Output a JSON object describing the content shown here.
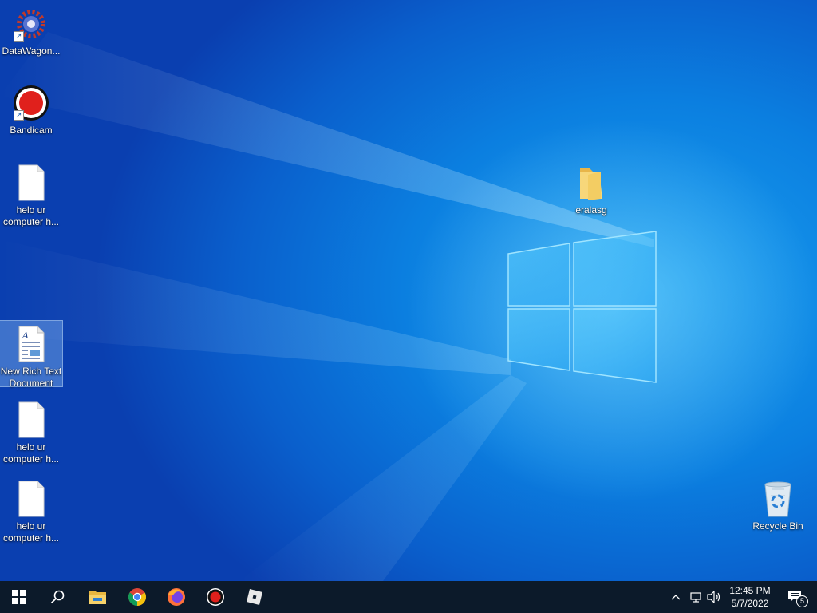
{
  "desktop": {
    "icons": [
      {
        "label": "DataWagon..."
      },
      {
        "label": "Bandicam"
      },
      {
        "label": "helo ur computer h..."
      },
      {
        "label": "New Rich Text Document"
      },
      {
        "label": "helo ur computer h..."
      },
      {
        "label": "helo ur computer h..."
      },
      {
        "label": "eralasg"
      },
      {
        "label": "Recycle Bin"
      }
    ]
  },
  "taskbar": {
    "apps": [
      "start-icon",
      "search-icon",
      "file-explorer-icon",
      "chrome-icon",
      "firefox-icon",
      "bandicam-icon",
      "roblox-icon"
    ],
    "clock_time": "12:45 PM",
    "clock_date": "5/7/2022",
    "notification_count": "5"
  },
  "colors": {
    "accent": "#0a78d7",
    "taskbar": "#0c1a2a"
  }
}
